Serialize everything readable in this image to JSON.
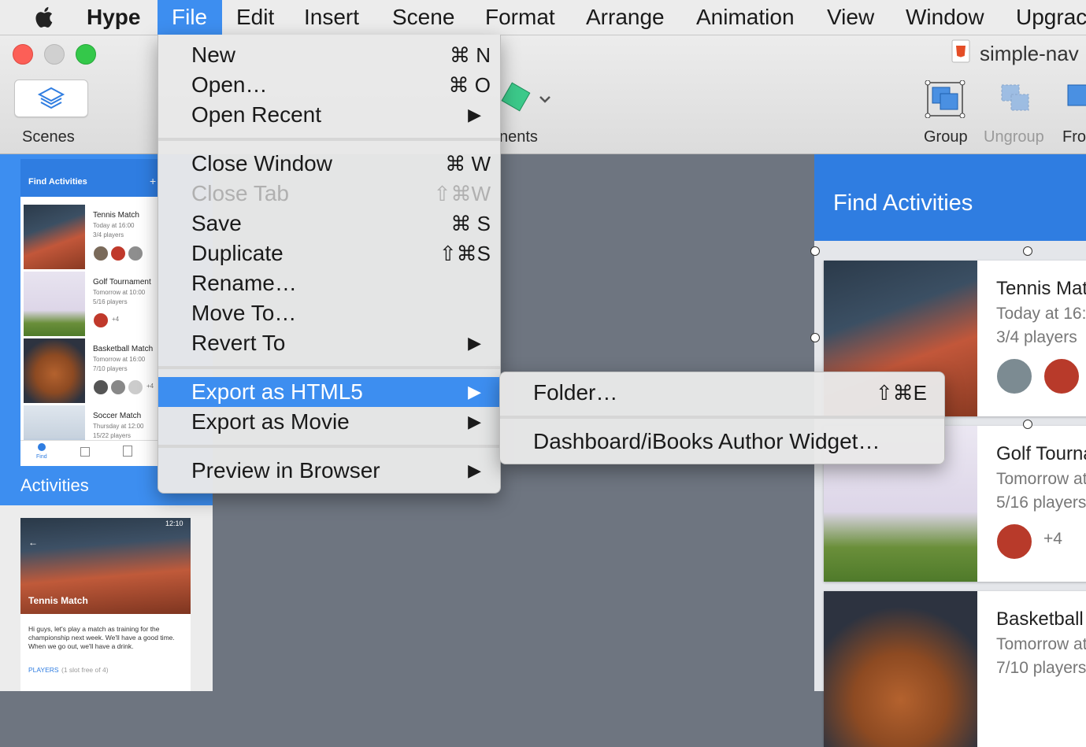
{
  "menubar": {
    "items": [
      "Hype",
      "File",
      "Edit",
      "Insert",
      "Scene",
      "Format",
      "Arrange",
      "Animation",
      "View",
      "Window",
      "Upgrac"
    ]
  },
  "toolbar": {
    "scenes_label": "Scenes",
    "elements_label_partial": "nents",
    "group_label": "Group",
    "ungroup_label": "Ungroup",
    "front_label_partial": "Fro",
    "document_title": "simple-nav"
  },
  "scene_thumbs": {
    "activities": {
      "header": "Find Activities",
      "plus": "+",
      "cards": [
        {
          "title": "Tennis Match",
          "time": "Today at 16:00",
          "players": "3/4 players"
        },
        {
          "title": "Golf Tournament",
          "time": "Tomorrow at 10:00",
          "players": "5/16 players",
          "extra": "+4"
        },
        {
          "title": "Basketball Match",
          "time": "Tomorrow at 16:00",
          "players": "7/10 players",
          "extra": "+4"
        },
        {
          "title": "Soccer Match",
          "time": "Thursday at 12:00",
          "players": "15/22 players"
        }
      ],
      "nav_find": "Find",
      "label": "Activities"
    },
    "detail": {
      "time": "12:10",
      "title": "Tennis Match",
      "body": "Hi guys, let's play a match as training for the championship next week. We'll have a good time. When we go out, we'll have a drink.",
      "players_label": "PLAYERS",
      "players_note": "(1 slot free of 4)"
    }
  },
  "canvas_doc": {
    "header": "Find Activities",
    "cards": [
      {
        "title": "Tennis Mat",
        "time": "Today at 16:",
        "players": "3/4 players"
      },
      {
        "title": "Golf Tourna",
        "time": "Tomorrow at",
        "players": "5/16 players",
        "extra": "+4"
      },
      {
        "title": "Basketball",
        "time": "Tomorrow at",
        "players": "7/10 players"
      }
    ]
  },
  "file_menu": {
    "items": [
      {
        "label": "New",
        "shortcut": "⌘ N"
      },
      {
        "label": "Open…",
        "shortcut": "⌘ O"
      },
      {
        "label": "Open Recent",
        "arrow": "▶"
      },
      {
        "label": "Close Window",
        "shortcut": "⌘ W"
      },
      {
        "label": "Close Tab",
        "shortcut": "⇧⌘W",
        "disabled": true
      },
      {
        "label": "Save",
        "shortcut": "⌘ S"
      },
      {
        "label": "Duplicate",
        "shortcut": "⇧⌘S"
      },
      {
        "label": "Rename…"
      },
      {
        "label": "Move To…"
      },
      {
        "label": "Revert To",
        "arrow": "▶"
      },
      {
        "label": "Export as HTML5",
        "arrow": "▶",
        "highlighted": true
      },
      {
        "label": "Export as Movie",
        "arrow": "▶"
      },
      {
        "label": "Preview in Browser",
        "arrow": "▶"
      }
    ]
  },
  "export_submenu": {
    "items": [
      {
        "label": "Folder…",
        "shortcut": "⇧⌘E"
      },
      {
        "label": "Dashboard/iBooks Author Widget…"
      }
    ]
  },
  "colors": {
    "accent": "#3d8ef0",
    "header_blue": "#2f7de1",
    "canvas": "#6e7580"
  }
}
